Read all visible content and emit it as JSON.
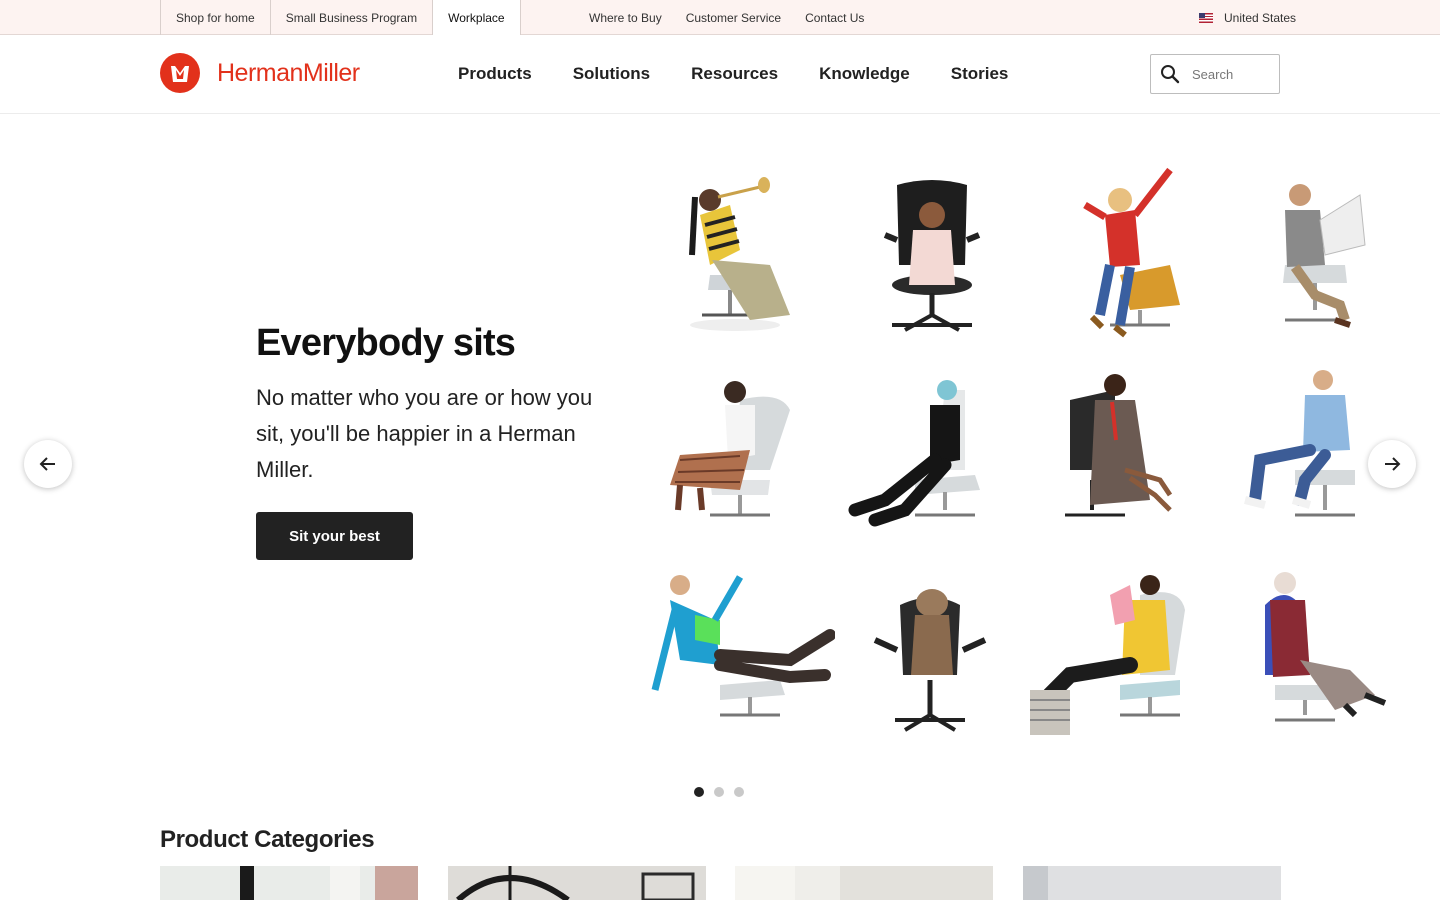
{
  "utility_bar": {
    "tabs": [
      {
        "label": "Shop for home"
      },
      {
        "label": "Small Business Program"
      },
      {
        "label": "Workplace"
      }
    ],
    "links": [
      "Where to Buy",
      "Customer Service",
      "Contact Us"
    ],
    "region": "United States"
  },
  "header": {
    "brand": "HermanMiller",
    "nav": [
      "Products",
      "Solutions",
      "Resources",
      "Knowledge",
      "Stories"
    ],
    "search_placeholder": "Search"
  },
  "hero": {
    "title": "Everybody sits",
    "body": "No matter who you are or how you sit, you'll be happier in a Herman Miller.",
    "cta": "Sit your best",
    "slides_total": 3,
    "active_slide": 1
  },
  "categories": {
    "title": "Product Categories"
  },
  "colors": {
    "brand": "#e2311b",
    "utility_bg": "#fdf3f1",
    "button": "#222222"
  }
}
